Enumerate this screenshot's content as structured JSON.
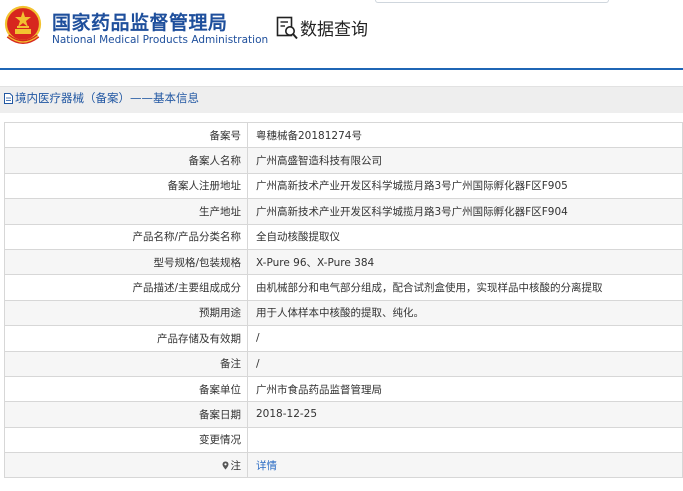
{
  "header": {
    "title_cn": "国家药品监督管理局",
    "title_en": "National Medical Products Administration",
    "query_title": "数据查询"
  },
  "breadcrumb": {
    "text": "境内医疗器械（备案）——基本信息"
  },
  "record": {
    "rows": [
      {
        "label": "备案号",
        "value": "粤穗械备20181274号"
      },
      {
        "label": "备案人名称",
        "value": "广州高盛智造科技有限公司"
      },
      {
        "label": "备案人注册地址",
        "value": "广州高新技术产业开发区科学城揽月路3号广州国际孵化器F区F905"
      },
      {
        "label": "生产地址",
        "value": "广州高新技术产业开发区科学城揽月路3号广州国际孵化器F区F904"
      },
      {
        "label": "产品名称/产品分类名称",
        "value": "全自动核酸提取仪"
      },
      {
        "label": "型号规格/包装规格",
        "value": "X-Pure 96、X-Pure 384"
      },
      {
        "label": "产品描述/主要组成成分",
        "value": "由机械部分和电气部分组成，配合试剂盒使用，实现样品中核酸的分离提取"
      },
      {
        "label": "预期用途",
        "value": "用于人体样本中核酸的提取、纯化。"
      },
      {
        "label": "产品存储及有效期",
        "value": "/"
      },
      {
        "label": "备注",
        "value": "/"
      },
      {
        "label": "备案单位",
        "value": "广州市食品药品监督管理局"
      },
      {
        "label": "备案日期",
        "value": "2018-12-25"
      },
      {
        "label": "变更情况",
        "value": ""
      }
    ],
    "note_label": "注",
    "note_link": "详情"
  },
  "colors": {
    "brand_blue": "#1e4f9c",
    "emblem_red": "#d7261e",
    "emblem_gold": "#f2c230",
    "link_blue": "#2b6cc4"
  }
}
